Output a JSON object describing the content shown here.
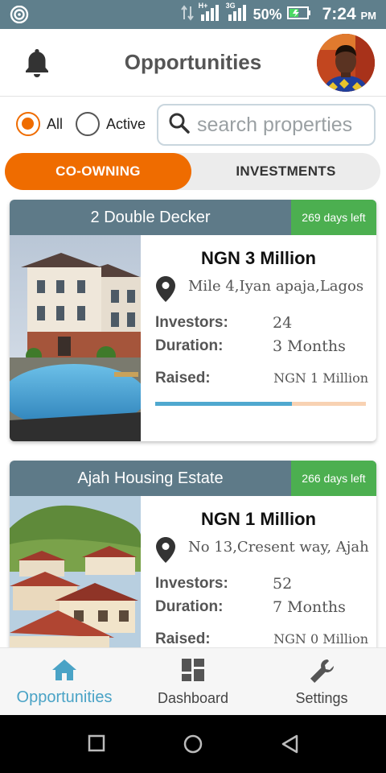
{
  "status_bar": {
    "network_1": "H+",
    "network_2": "3G",
    "battery": "50%",
    "time": "7:24",
    "ampm": "PM",
    "icons": [
      "wifi-icon",
      "data-arrows-icon",
      "signal-icon",
      "signal-icon",
      "battery-charging-icon"
    ]
  },
  "header": {
    "title": "Opportunities",
    "left_icon": "bell-icon",
    "right_icon": "avatar"
  },
  "filters": {
    "options": [
      {
        "label": "All",
        "selected": true
      },
      {
        "label": "Active",
        "selected": false
      }
    ],
    "search_placeholder": "search properties"
  },
  "tabs": [
    {
      "label": "CO-OWNING",
      "active": true
    },
    {
      "label": "INVESTMENTS",
      "active": false
    }
  ],
  "labels": {
    "investors": "Investors:",
    "duration": "Duration:",
    "raised": "Raised:"
  },
  "listings": [
    {
      "title": "2 Double Decker",
      "days_left": "269 days left",
      "price": "NGN 3 Million",
      "location": "Mile 4,Iyan apaja,Lagos",
      "investors": "24",
      "duration": "3 Months",
      "raised": "NGN 1 Million",
      "raised_fraction": 0.65
    },
    {
      "title": "Ajah Housing Estate",
      "days_left": "266 days left",
      "price": "NGN 1 Million",
      "location": "No 13,Cresent way, Ajah",
      "investors": "52",
      "duration": "7 Months",
      "raised": "NGN 0 Million",
      "raised_fraction": 0
    }
  ],
  "bottom_nav": [
    {
      "label": "Opportunities",
      "icon": "home-icon",
      "active": true
    },
    {
      "label": "Dashboard",
      "icon": "dashboard-icon",
      "active": false
    },
    {
      "label": "Settings",
      "icon": "wrench-icon",
      "active": false
    }
  ],
  "colors": {
    "accent": "#ef6c00",
    "header_bar": "#5e7a88",
    "badge": "#4caf50",
    "progress_fill": "#4fa8cf",
    "active_nav": "#4aa3c6"
  }
}
